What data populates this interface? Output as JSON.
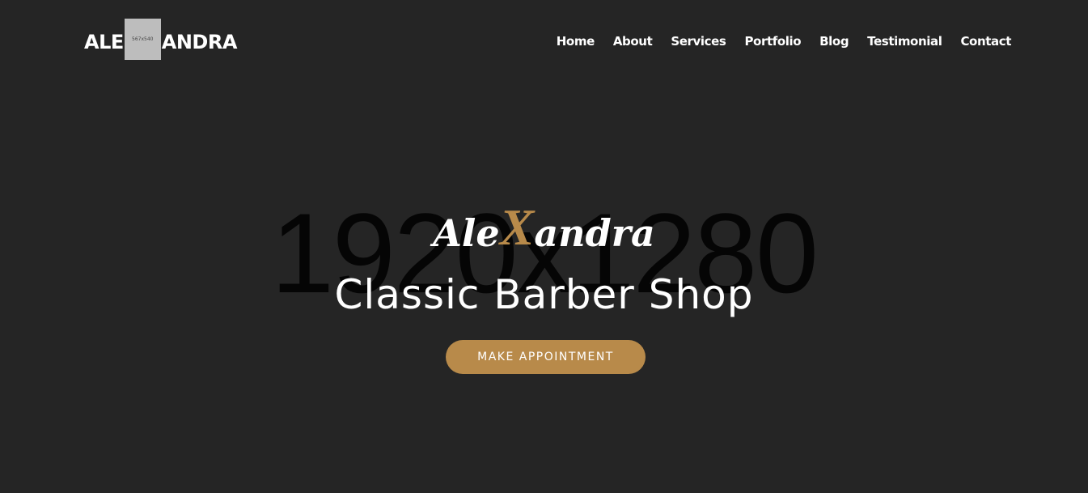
{
  "header": {
    "logo_left": "ALE",
    "logo_image_text": "567x540",
    "logo_right": "ANDRA",
    "nav": [
      {
        "label": "Home"
      },
      {
        "label": "About"
      },
      {
        "label": "Services"
      },
      {
        "label": "Portfolio"
      },
      {
        "label": "Blog"
      },
      {
        "label": "Testimonial"
      },
      {
        "label": "Contact"
      }
    ]
  },
  "hero": {
    "background_placeholder": "1920x1280",
    "brand_before": "Ale",
    "brand_accent": "X",
    "brand_after": "andra",
    "tagline": "Classic Barber Shop",
    "cta_label": "MAKE APPOINTMENT"
  },
  "colors": {
    "background": "#252525",
    "accent": "#b88a4a",
    "text": "#ffffff"
  }
}
